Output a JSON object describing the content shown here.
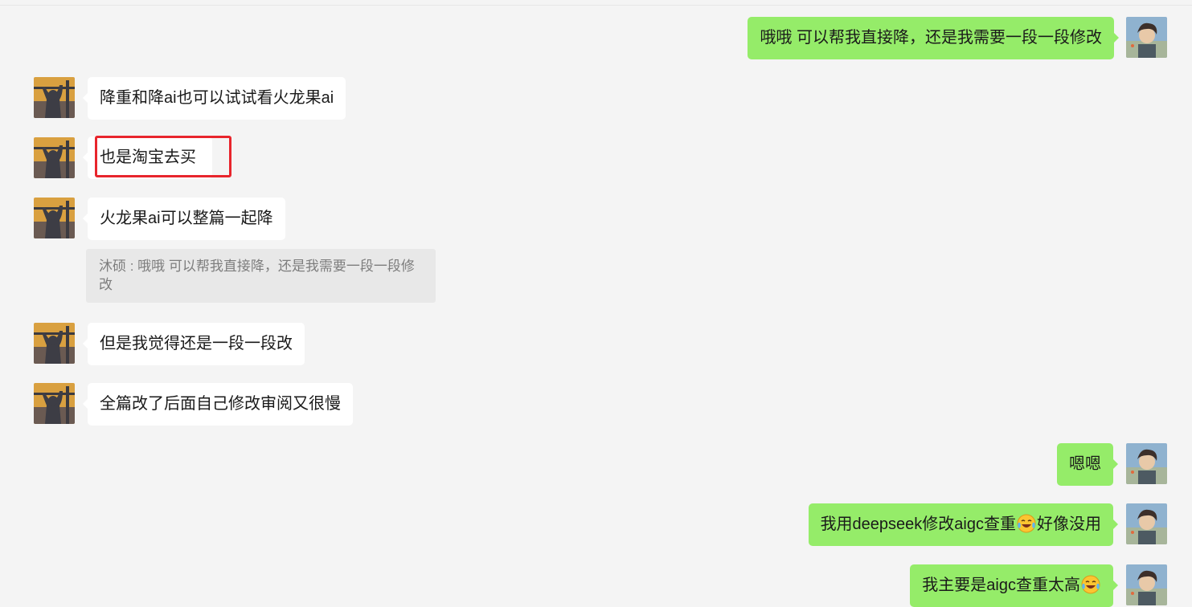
{
  "messages": [
    {
      "side": "out",
      "text": "哦哦 可以帮我直接降，还是我需要一段一段修改"
    },
    {
      "side": "in",
      "text": "降重和降ai也可以试试看火龙果ai"
    },
    {
      "side": "in",
      "text": "也是淘宝去买"
    },
    {
      "side": "in",
      "text": "火龙果ai可以整篇一起降"
    },
    {
      "side": "in",
      "text": "但是我觉得还是一段一段改"
    },
    {
      "side": "in",
      "text": "全篇改了后面自己修改审阅又很慢"
    },
    {
      "side": "out",
      "text": "嗯嗯"
    },
    {
      "side": "out",
      "text_before": "我用deepseek修改aigc查重",
      "emoji": "laughing-crying-emoji",
      "text_after": "好像没用"
    },
    {
      "side": "out",
      "text_before": "我主要是aigc查重太高",
      "emoji": "laughing-crying-emoji"
    }
  ],
  "quote": {
    "text": "沐硕 : 哦哦 可以帮我直接降，还是我需要一段一段修改"
  },
  "colors": {
    "background": "#f4f4f4",
    "incoming_bubble": "#ffffff",
    "outgoing_bubble": "#95ec69",
    "quote_bg": "#e8e8e8",
    "highlight": "#e8252c"
  },
  "avatars": {
    "self": "anime-boy-avatar",
    "contact": "silhouette-sunset-avatar"
  }
}
